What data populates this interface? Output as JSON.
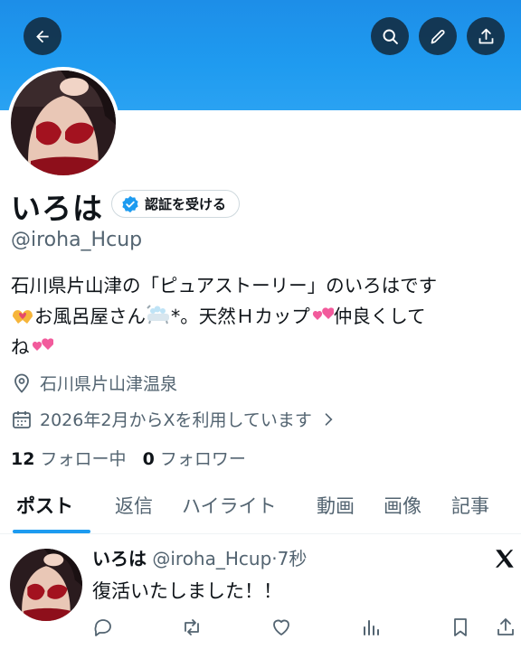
{
  "header": {
    "back_icon": "arrow-left-icon",
    "search_icon": "search-icon",
    "edit_icon": "pencil-icon",
    "share_icon": "share-icon",
    "banner_color": "#1d9bf0"
  },
  "profile": {
    "name": "いろは",
    "verify_label": "認証を受ける",
    "handle": "@iroha_Hcup",
    "bio_line1": "石川県片山津の「ピュアストーリー」のいろはです",
    "bio_line2a": "お風呂屋さん",
    "bio_line2b": "*。天然Ｈカップ",
    "bio_line2c": "仲良くして",
    "bio_line3": "ね",
    "location": "石川県片山津温泉",
    "joined": "2026年2月からXを利用しています",
    "following_count": "12",
    "following_label": "フォロー中",
    "followers_count": "0",
    "followers_label": "フォロワー"
  },
  "tabs": [
    {
      "label": "ポスト",
      "active": true
    },
    {
      "label": "返信"
    },
    {
      "label": "ハイライト"
    },
    {
      "label": "動画"
    },
    {
      "label": "画像"
    },
    {
      "label": "記事"
    }
  ],
  "tweet": {
    "name": "いろは",
    "handle": "@iroha_Hcup",
    "separator": "·",
    "time": "7秒",
    "text": "復活いたしました！！",
    "actions": [
      "reply-icon",
      "retweet-icon",
      "like-icon",
      "views-icon",
      "bookmark-icon",
      "share-icon"
    ]
  },
  "colors": {
    "accent": "#1d9bf0",
    "secondary_text": "#536471",
    "primary_text": "#0f1419"
  }
}
